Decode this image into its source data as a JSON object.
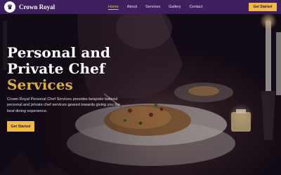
{
  "brand": {
    "name": "Crown Royal",
    "logo_glyph": "♛"
  },
  "nav": {
    "links": [
      {
        "label": "Home",
        "active": true
      },
      {
        "label": "About",
        "active": false
      },
      {
        "label": "Services",
        "active": false
      },
      {
        "label": "Gallery",
        "active": false
      },
      {
        "label": "Contact",
        "active": false
      }
    ],
    "cta_label": "Get Started"
  },
  "hero": {
    "title_line1": "Personal and",
    "title_line2": "Private Chef",
    "title_accent": "Services",
    "description": "Crown Royal Personal Chef Services provides bespoke tailored personal and private chef services geared towards giving you the best dining experience.",
    "cta_label": "Get Started"
  },
  "colors": {
    "navbar": "#3f1f5e",
    "accent_gold": "#d8ad4e",
    "button": "#f0b947"
  }
}
